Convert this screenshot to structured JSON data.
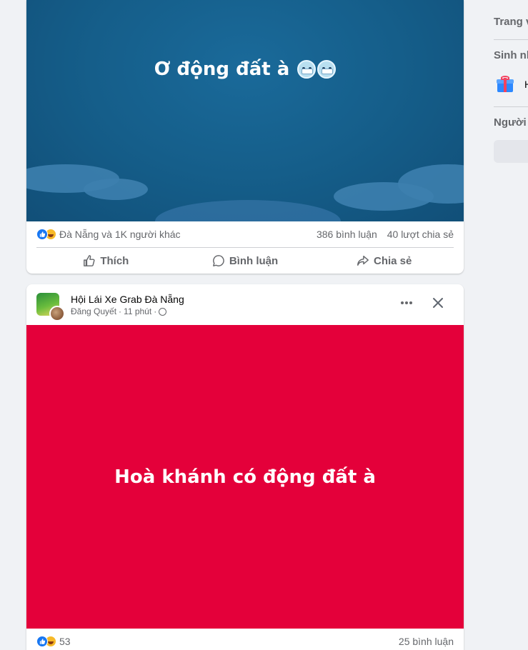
{
  "post1": {
    "text": "Ơ động đất à",
    "emoji": "cold-face-emoji",
    "background_color": "#155e8a",
    "reactions_text": "Đà Nẵng và 1K người khác",
    "comments": "386 bình luận",
    "shares": "40 lượt chia sẻ",
    "actions": {
      "like": "Thích",
      "comment": "Bình luận",
      "share": "Chia sẻ"
    }
  },
  "post2": {
    "group_name": "Hội Lái Xe Grab Đà Nẵng",
    "author": "Đăng Quyết",
    "time": "11 phút",
    "text": "Hoà khánh có động đất à",
    "background_color": "#e4003a",
    "reaction_count": "53",
    "comments": "25 bình luận"
  },
  "sidebar": {
    "section1": "Trang v",
    "section2": "Sinh nh",
    "birthday_text": "H",
    "section3": "Người"
  },
  "colors": {
    "like_blue": "#1877f2",
    "haha_yellow": "#f7b928",
    "text_secondary": "#65676b"
  }
}
